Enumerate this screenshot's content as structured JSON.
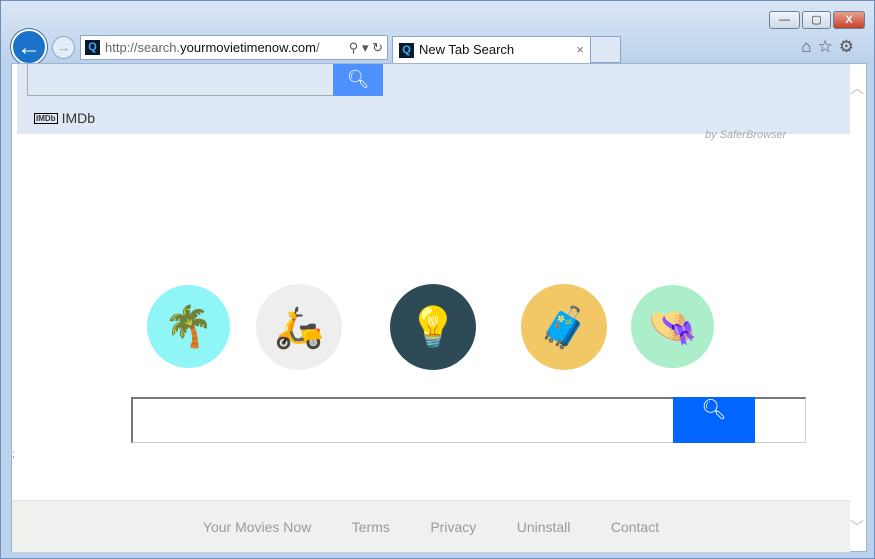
{
  "window": {
    "minimize": "—",
    "maximize": "▢",
    "close": "X"
  },
  "address": {
    "prefix": "http://search.",
    "domain": "yourmovietimenow.com",
    "suffix": "/"
  },
  "tab": {
    "title": "New Tab Search",
    "close": "×"
  },
  "toolbar": {
    "imdb_logo": "IMDb",
    "imdb_label": "IMDb",
    "by": "by SaferBrowser"
  },
  "categories": [
    {
      "name": "beach",
      "icon": "palm-tree-icon",
      "bg": "#8ff5f7",
      "glyph": "🌴"
    },
    {
      "name": "scooter",
      "icon": "scooter-icon",
      "bg": "#eeeeee",
      "glyph": "🛵"
    },
    {
      "name": "ideas",
      "icon": "lightbulb-suitcase-icon",
      "bg": "#2e4a57",
      "glyph": "💡"
    },
    {
      "name": "travel",
      "icon": "luggage-icon",
      "bg": "#f2c766",
      "glyph": "🧳"
    },
    {
      "name": "hat",
      "icon": "sun-hat-icon",
      "bg": "#acedca",
      "glyph": "👒"
    }
  ],
  "footer": {
    "links": [
      "Your Movies Now",
      "Terms",
      "Privacy",
      "Uninstall",
      "Contact"
    ]
  },
  "colors": {
    "search_button": "#0066ff",
    "top_search_button": "#4d90fe",
    "toolbar_bg": "#dee9f5"
  }
}
